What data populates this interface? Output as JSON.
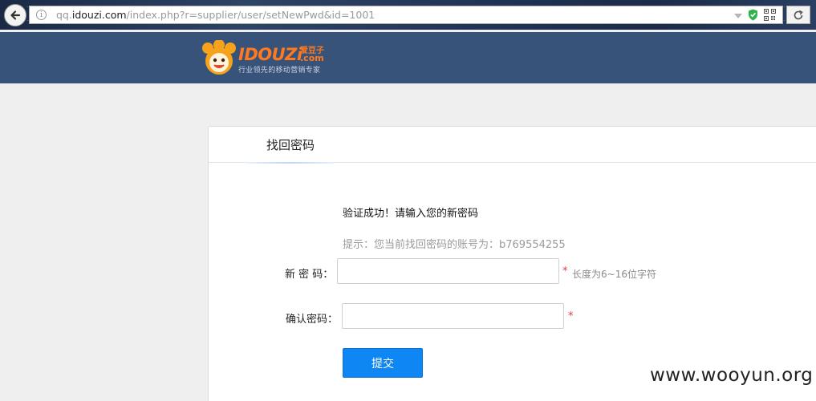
{
  "browser": {
    "url_prefix": "qq.",
    "url_host": "idouzi.com",
    "url_path": "/index.php?r=supplier/user/setNewPwd&id=1001",
    "info_glyph": "i"
  },
  "header": {
    "logo_word": "IDOUZi",
    "logo_cn": "爱豆子",
    "logo_com": ".com",
    "logo_slogan": "行业领先的移动营销专家"
  },
  "panel": {
    "tab_label": "找回密码",
    "success_message": "验证成功！请输入您的新密码",
    "hint_message": "提示：您当前找回密码的账号为：b769554255",
    "new_password_label": "新 密 码：",
    "new_password_value": "",
    "new_password_required": "*",
    "length_hint": "长度为6~16位字符",
    "confirm_password_label": "确认密码：",
    "confirm_password_value": "",
    "confirm_password_required": "*",
    "submit_label": "提交"
  },
  "watermark": "www.wooyun.org",
  "colors": {
    "header_bg": "#385379",
    "brand_orange": "#ff7a1e",
    "submit_blue": "#0e86f3",
    "required_red": "#e23a3a"
  },
  "icons": [
    "back-arrow-icon",
    "info-icon",
    "dropdown-icon",
    "shield-icon",
    "qr-code-icon",
    "reload-icon",
    "logo-mascot-icon"
  ]
}
